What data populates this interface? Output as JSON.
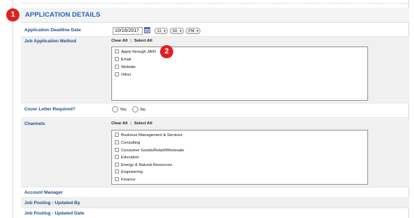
{
  "badges": {
    "one": "1",
    "two": "2"
  },
  "section": {
    "title": "APPLICATION DETAILS"
  },
  "deadline": {
    "label": "Application Deadline Date",
    "date": "10/16/2017",
    "hour": "11",
    "minute": "59",
    "ampm": "PM"
  },
  "method": {
    "label": "Job Application Method",
    "clear_all": "Clear All",
    "separator": "|",
    "select_all": "Select All",
    "options": [
      "Apply through JAIN",
      "Email",
      "Website",
      "Other"
    ]
  },
  "cover_letter": {
    "label": "Cover Letter Required?",
    "yes": "Yes",
    "no": "No"
  },
  "channels": {
    "label": "Channels",
    "clear_all": "Clear All",
    "separator": "|",
    "select_all": "Select All",
    "options": [
      "Business Management & Services",
      "Consulting",
      "Consumer Goods/Retail/Wholesale",
      "Education",
      "Energy & Natural Resources",
      "Engineering",
      "Finance"
    ]
  },
  "fields": {
    "account_manager": "Account Manager",
    "updated_by": "Job Posting - Updated By",
    "updated_date": "Job Posting - Updated Date"
  },
  "colors": {
    "accent": "#2463b8",
    "label": "#1e4f8a",
    "badge": "#e02020",
    "row_shade": "#f0f0f0"
  },
  "icons": {
    "calendar": "calendar-icon",
    "chevron": "chevron-down-icon"
  }
}
